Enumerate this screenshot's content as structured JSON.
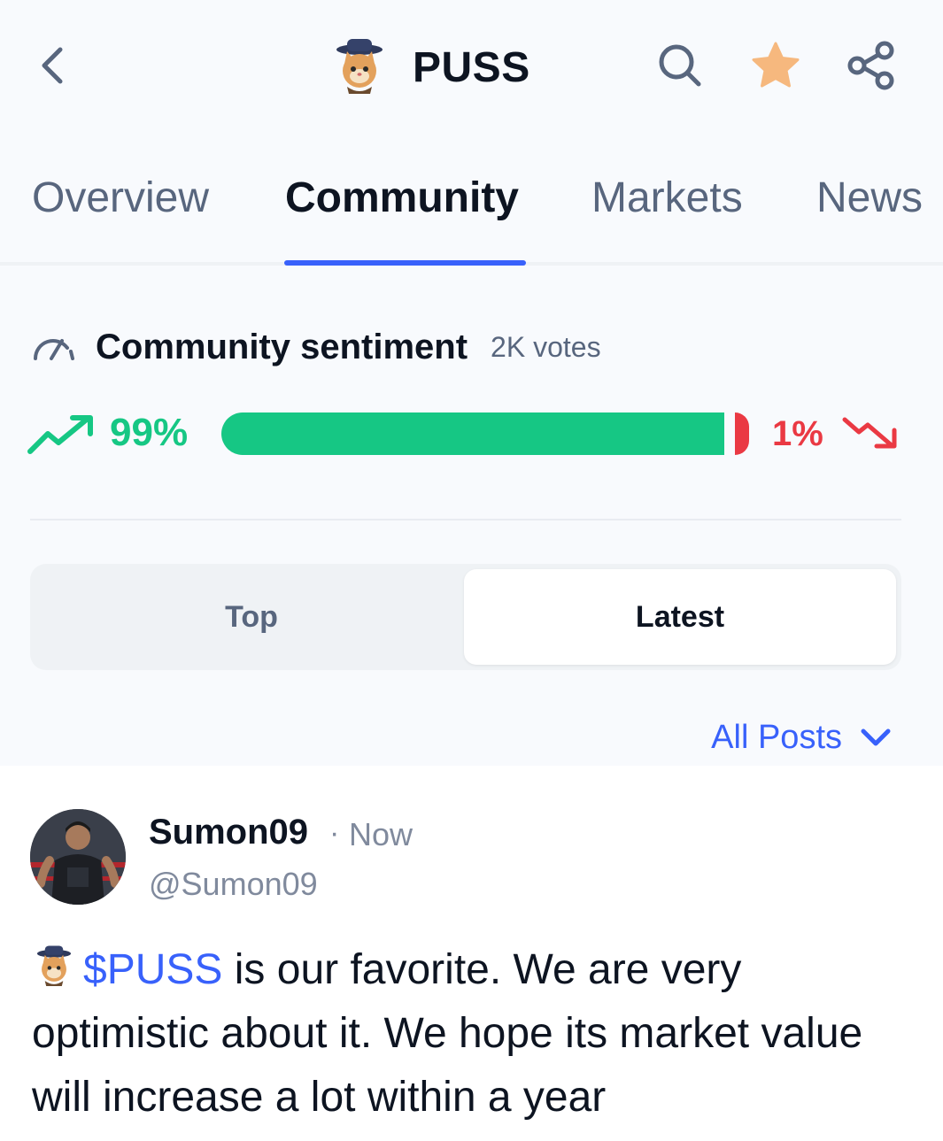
{
  "header": {
    "title": "PUSS",
    "icons": {
      "back": "chevron-left-icon",
      "search": "search-icon",
      "watchlist": "star-icon",
      "share": "share-icon"
    }
  },
  "tabs": [
    {
      "label": "Overview",
      "active": false
    },
    {
      "label": "Community",
      "active": true
    },
    {
      "label": "Markets",
      "active": false
    },
    {
      "label": "News",
      "active": false
    }
  ],
  "sentiment": {
    "title": "Community sentiment",
    "votes": "2K votes",
    "bullish_pct_label": "99%",
    "bearish_pct_label": "1%",
    "bullish_fraction": 0.99,
    "bearish_fraction": 0.01
  },
  "segmented": {
    "options": [
      "Top",
      "Latest"
    ],
    "selected": "Latest"
  },
  "filter": {
    "label": "All Posts"
  },
  "post": {
    "username": "Sumon09",
    "separator": "·",
    "time": "Now",
    "handle": "@Sumon09",
    "ticker": "$PUSS",
    "text": " is our favorite. We are very optimistic about it. We hope its market value will increase a lot within a year"
  },
  "colors": {
    "accent": "#3861fb",
    "bullish": "#16c784",
    "bearish": "#ea3943",
    "star": "#f6b87e"
  }
}
